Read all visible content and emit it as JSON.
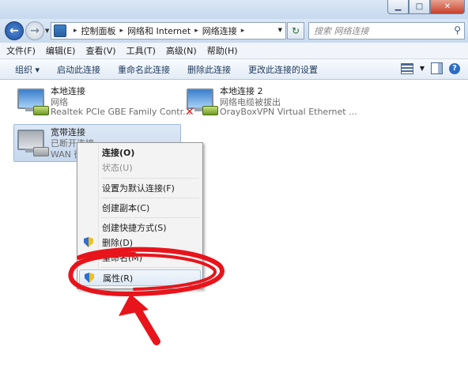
{
  "window": {
    "min_icon": "minimize-icon",
    "max_icon": "maximize-icon",
    "close_icon": "close-icon"
  },
  "address_bar": {
    "crumbs": [
      "控制面板",
      "网络和 Internet",
      "网络连接"
    ],
    "search_placeholder": "搜索 网络连接"
  },
  "menu": [
    "文件(F)",
    "编辑(E)",
    "查看(V)",
    "工具(T)",
    "高级(N)",
    "帮助(H)"
  ],
  "commands": [
    "组织 ▾",
    "启动此连接",
    "重命名此连接",
    "删除此连接",
    "更改此连接的设置"
  ],
  "connections": [
    {
      "name": "本地连接",
      "status": "网络",
      "device": "Realtek PCIe GBE Family Contr..."
    },
    {
      "name": "本地连接 2",
      "status": "网络电缆被拔出",
      "device": "OrayBoxVPN Virtual Ethernet ..."
    },
    {
      "name": "宽带连接",
      "status": "已断开连接",
      "device": "WAN 微型端口 (PPPOE)"
    }
  ],
  "context_menu": {
    "items": [
      "连接(O)",
      "状态(U)",
      "设置为默认连接(F)",
      "创建副本(C)",
      "创建快捷方式(S)",
      "删除(D)",
      "重命名(M)",
      "属性(R)"
    ]
  },
  "colors": {
    "annotation": "#e8141b",
    "accent": "#2c6bc3"
  }
}
